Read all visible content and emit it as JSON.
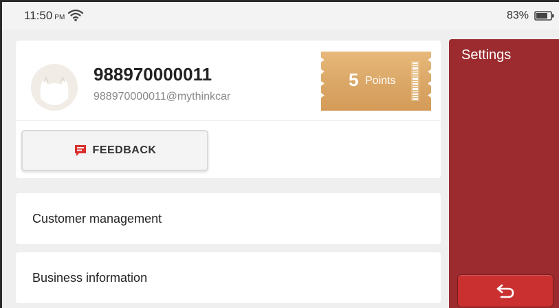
{
  "status_bar": {
    "time": "11:50",
    "meridiem": "PM",
    "battery_percent": "83%",
    "wifi_icon": "wifi-icon",
    "battery_icon": "battery-icon"
  },
  "profile": {
    "user_id": "988970000011",
    "email": "988970000011@mythinkcar",
    "points_value": "5",
    "points_label": "Points"
  },
  "feedback": {
    "label": "FEEDBACK",
    "icon": "feedback-chat-icon"
  },
  "menu": {
    "items": [
      {
        "label": "Customer management"
      },
      {
        "label": "Business information"
      }
    ]
  },
  "settings_panel": {
    "title": "Settings",
    "back_icon": "back-arrow-icon"
  },
  "colors": {
    "accent": "#9b2b2e",
    "button_red": "#c9302f",
    "ticket_gold": "#dba868",
    "feedback_icon": "#d9302e"
  }
}
